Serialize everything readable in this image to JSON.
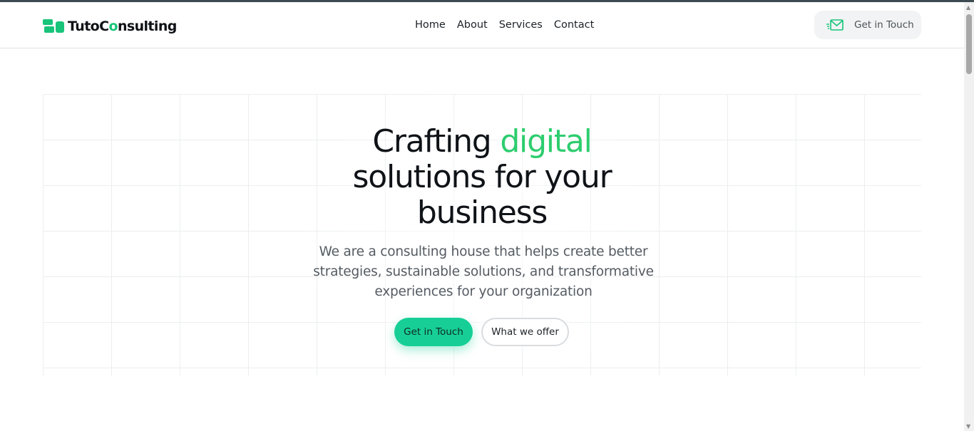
{
  "brand": {
    "name_part1": "TutoC",
    "name_o": "o",
    "name_part2": "nsulting",
    "accent_color": "#17c47a"
  },
  "nav": {
    "items": [
      {
        "label": "Home"
      },
      {
        "label": "About"
      },
      {
        "label": "Services"
      },
      {
        "label": "Contact"
      }
    ]
  },
  "header_cta": {
    "label": "Get in Touch",
    "icon": "mail-fast-icon"
  },
  "hero": {
    "title_part1": "Crafting ",
    "title_accent": "digital",
    "title_part2": "solutions for your business",
    "subtitle": "We are a consulting house that helps create better strategies, sustainable solutions, and transformative experiences for your organization",
    "primary_button": "Get in Touch",
    "secondary_button": "What we offer",
    "accent_color": "#2dcd6e",
    "button_color": "#17cf96"
  },
  "scrollbar": {
    "up_arrow": "▲",
    "down_arrow": "▼"
  }
}
